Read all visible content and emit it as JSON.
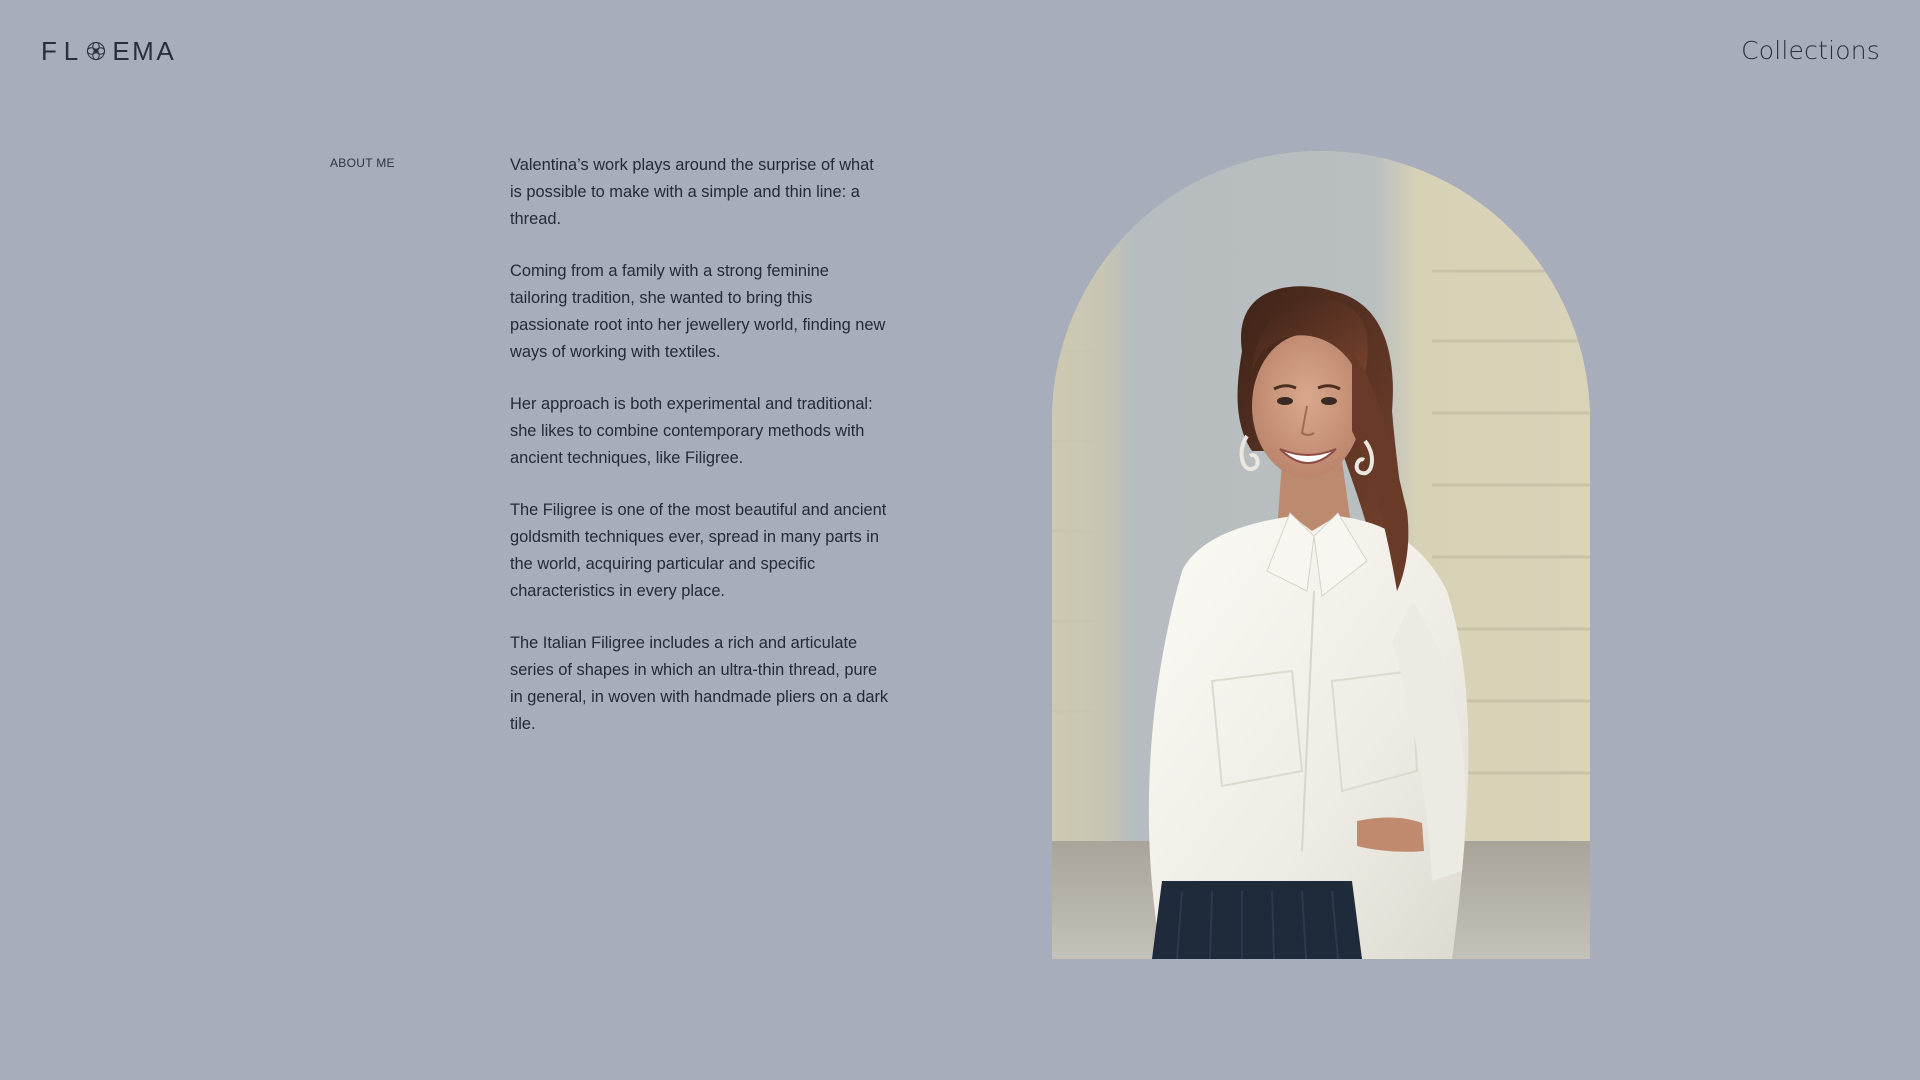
{
  "header": {
    "logo": {
      "letters_left": [
        "F",
        "L"
      ],
      "letters_right": [
        "E",
        "M",
        "A"
      ],
      "icon": "flower-icon",
      "wordmark": "FLOEMA"
    },
    "nav": {
      "collections_label": "Collections"
    }
  },
  "about": {
    "section_label": "ABOUT ME",
    "paragraphs": [
      "Valentina’s work plays around the surprise of what is possible to make with a simple and thin line: a thread.",
      "Coming from a family with a strong feminine tailoring tradition, she wanted to bring this passionate root into her jewellery world, finding new ways of working with textiles.",
      "Her approach is both experimental and traditional: she likes to combine contemporary methods with ancient techniques, like Filigree.",
      "The Filigree is one of the most beautiful and ancient goldsmith techniques ever, spread in many parts in the world, acquiring particular and specific characteristics in every place.",
      "The Italian Filigree includes a rich and articulate series of shapes in which an ultra-thin thread, pure in general, in woven with handmade pliers on a dark tile."
    ]
  },
  "portrait": {
    "shape": "arch",
    "colors": {
      "wall": "#d3ceb6",
      "pillar": "#b7bdc0",
      "shirt": "#f2f1ea",
      "skirt": "#1f2a3a",
      "hair": "#5a3323",
      "skin": "#c99478"
    }
  },
  "theme": {
    "background": "#a8adbb",
    "text": "#262a36"
  }
}
